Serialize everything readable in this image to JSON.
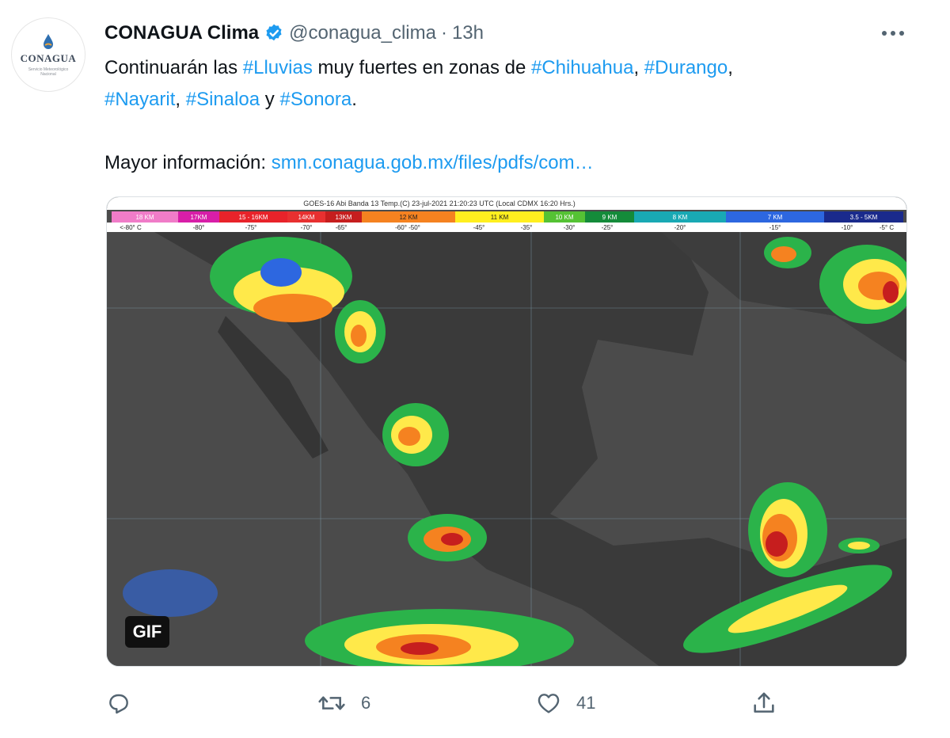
{
  "tweet": {
    "author": {
      "name": "CONAGUA Clima",
      "handle": "@conagua_clima",
      "separator": "·",
      "time": "13h",
      "avatar_org": "CONAGUA",
      "avatar_sub": "Servicio Meteorológico Nacional"
    },
    "text": {
      "line1_a": "Continuarán las ",
      "tag_lluvias": "#Lluvias",
      "line1_b": " muy fuertes en zonas de ",
      "tag_chihuahua": "#Chihuahua",
      "comma1": ", ",
      "tag_durango": "#Durango",
      "comma2": ",",
      "tag_nayarit": "#Nayarit",
      "comma3": ", ",
      "tag_sinaloa": "#Sinaloa",
      "and": " y ",
      "tag_sonora": "#Sonora",
      "period": ".",
      "info_label": "Mayor información: ",
      "info_link": "smn.conagua.gob.mx/files/pdfs/com…"
    },
    "media": {
      "badge": "GIF",
      "map_title": "GOES-16 Abi Banda 13 Temp.(C) 23-jul-2021 21:20:23 UTC (Local CDMX 16:20 Hrs.)",
      "scale_heights": [
        "18 KM",
        "17KM",
        "15 - 16KM",
        "14KM",
        "13KM",
        "12 KM",
        "11 KM",
        "10 KM",
        "9 KM",
        "8 KM",
        "7 KM",
        "3.5 - 5KM"
      ],
      "scale_temps": [
        "<-80° C",
        "-80°",
        "-75°",
        "-70°",
        "-65°",
        "-60° -50°",
        "-45°",
        "-35°",
        "-30°",
        "-25°",
        "-20°",
        "-15°",
        "-10°",
        "-5° C"
      ]
    },
    "actions": {
      "reply_count": "",
      "retweet_count": "6",
      "like_count": "41"
    }
  },
  "colors": {
    "link": "#1d9bf0",
    "secondary_text": "#536471",
    "verified_badge": "#1d9bf0"
  },
  "icons": [
    "reply-icon",
    "retweet-icon",
    "like-icon",
    "share-icon",
    "more-icon",
    "verified-icon"
  ]
}
